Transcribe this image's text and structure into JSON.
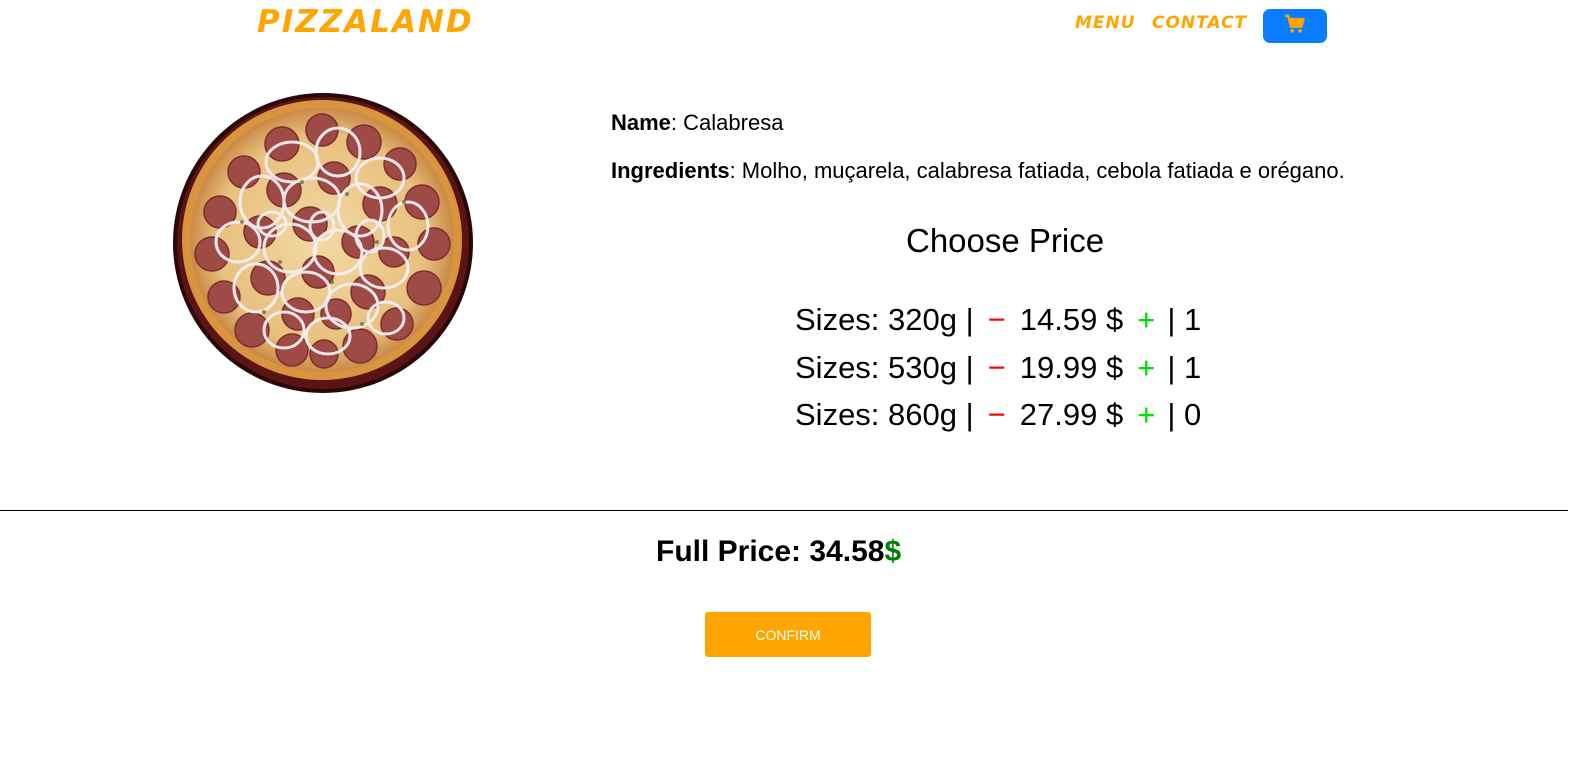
{
  "header": {
    "brand": "PIZZALAND",
    "nav": {
      "menu": "MENU",
      "contact": "CONTACT"
    },
    "cart_icon": "cart-icon"
  },
  "product": {
    "image_icon": "pizza-image",
    "name_label": "Name",
    "name_value": ": Calabresa",
    "ingredients_label": "Ingredients",
    "ingredients_value": ": Molho, muçarela, calabresa fatiada, cebola fatiada e orégano."
  },
  "pricing": {
    "title": "Choose Price",
    "sizes": [
      {
        "prefix": "Sizes: 320g |",
        "minus": "−",
        "price": "14.59 $",
        "plus": "+",
        "qty": "| 1"
      },
      {
        "prefix": "Sizes: 530g |",
        "minus": "−",
        "price": "19.99 $",
        "plus": "+",
        "qty": "| 1"
      },
      {
        "prefix": "Sizes: 860g |",
        "minus": "−",
        "price": "27.99 $",
        "plus": "+",
        "qty": "| 0"
      }
    ]
  },
  "summary": {
    "label": "Full Price: ",
    "amount": "34.58",
    "currency": "$"
  },
  "actions": {
    "confirm": "CONFIRM"
  },
  "colors": {
    "brand": "#ffa500",
    "cart_button": "#0a7cff",
    "minus": "#ff0000",
    "plus": "#00e000",
    "currency": "#008000"
  }
}
